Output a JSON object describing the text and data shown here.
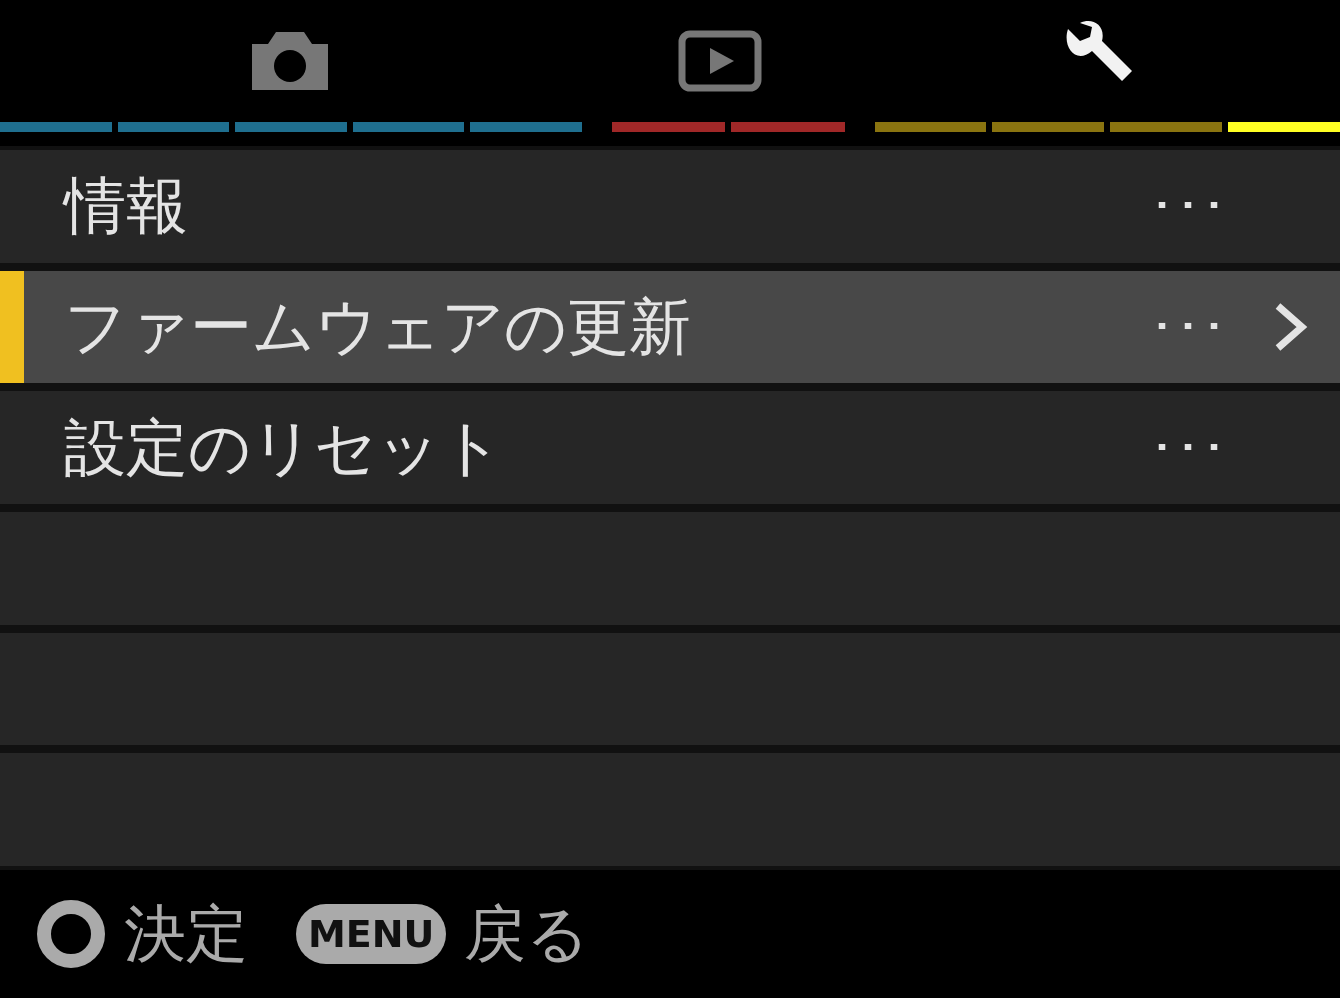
{
  "tabs": [
    {
      "kind": "camera",
      "selected": false
    },
    {
      "kind": "playback",
      "selected": false
    },
    {
      "kind": "setup",
      "selected": true
    }
  ],
  "page_indicator": [
    {
      "color": "#1f6f8f",
      "segments": [
        {
          "selected": false
        },
        {
          "selected": false
        },
        {
          "selected": false
        },
        {
          "selected": false
        },
        {
          "selected": false
        }
      ]
    },
    {
      "color": "#a02828",
      "segments": [
        {
          "selected": false
        },
        {
          "selected": false
        }
      ]
    },
    {
      "color": "#8a7410",
      "segments": [
        {
          "selected": false
        },
        {
          "selected": false
        },
        {
          "selected": false
        },
        {
          "selected": true
        }
      ]
    }
  ],
  "rows": [
    {
      "kind": "item",
      "label": "情報",
      "value": "･･･",
      "selected": false,
      "submenu": false
    },
    {
      "kind": "item",
      "label": "ファームウェアの更新",
      "value": "･･･",
      "selected": true,
      "submenu": true
    },
    {
      "kind": "item",
      "label": "設定のリセット",
      "value": "･･･",
      "selected": false,
      "submenu": false
    },
    {
      "kind": "empty"
    },
    {
      "kind": "empty"
    },
    {
      "kind": "empty"
    }
  ],
  "footer": [
    {
      "kind": "ok",
      "label": "決定"
    },
    {
      "kind": "menu",
      "key": "MENU",
      "label": "戻る"
    }
  ]
}
